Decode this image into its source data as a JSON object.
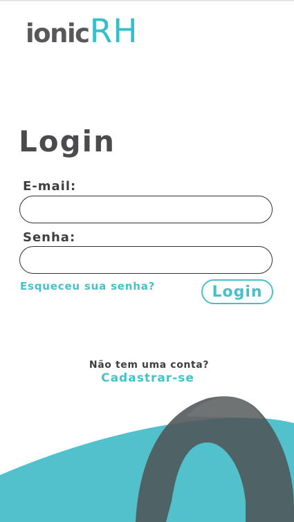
{
  "logo": {
    "part1": "ionic",
    "part2": "RH"
  },
  "page": {
    "title": "Login"
  },
  "form": {
    "email_label": "E-mail:",
    "email_value": "",
    "password_label": "Senha:",
    "password_value": "",
    "forgot_link": "Esqueceu sua senha?",
    "submit_label": "Login"
  },
  "signup": {
    "question": "Não tem uma conta?",
    "link": "Cadastrar-se"
  },
  "colors": {
    "accent": "#48c0ca",
    "dark_gray": "#58585a",
    "wave_teal": "#52c1cc",
    "arch_gray": "#5c6b6f"
  }
}
